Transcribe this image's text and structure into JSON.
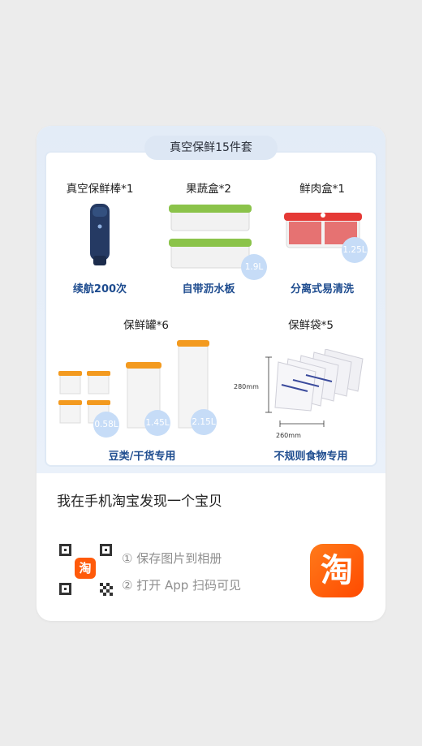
{
  "product": {
    "title": "真空保鲜15件套",
    "items": [
      {
        "name": "真空保鲜棒*1",
        "feature": "续航200次"
      },
      {
        "name": "果蔬盒*2",
        "feature": "自带沥水板",
        "capacity": "1.9L"
      },
      {
        "name": "鲜肉盒*1",
        "feature": "分离式易清洗",
        "capacity": "1.25L"
      },
      {
        "name": "保鲜罐*6",
        "feature": "豆类/干货专用",
        "capacities": [
          "0.58L",
          "1.45L",
          "2.15L"
        ]
      },
      {
        "name": "保鲜袋*5",
        "feature": "不规则食物专用",
        "dim_height": "280mm",
        "dim_width": "260mm"
      }
    ]
  },
  "share": {
    "headline": "我在手机淘宝发现一个宝贝",
    "step1": "① 保存图片到相册",
    "step2": "② 打开 App 扫码可见",
    "app_icon_char": "淘",
    "qr_badge_char": "淘"
  },
  "colors": {
    "feature_blue": "#1e4c8f",
    "green_lid": "#8bc34a",
    "red_lid": "#e53935",
    "orange_lid": "#f39a1f",
    "taobao_orange": "#ff5a0a"
  }
}
